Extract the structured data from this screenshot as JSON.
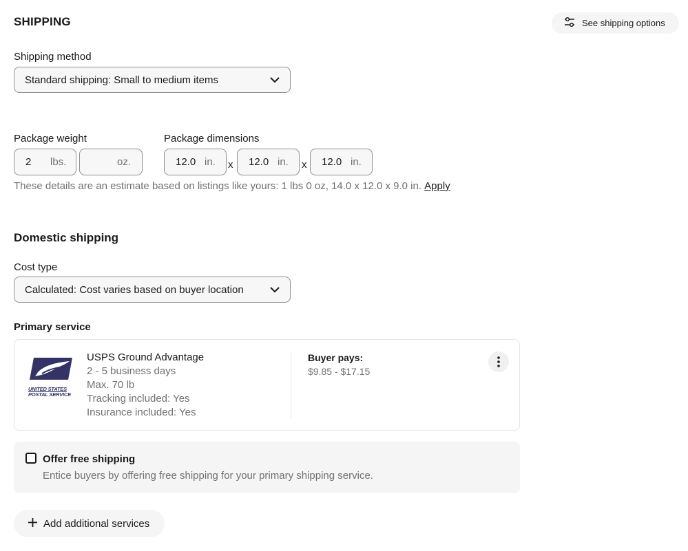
{
  "header": {
    "title": "SHIPPING",
    "options_button": "See shipping options"
  },
  "shipping_method": {
    "label": "Shipping method",
    "value": "Standard shipping: Small to medium items"
  },
  "package": {
    "weight_label": "Package weight",
    "weight_lbs": "2",
    "weight_lbs_unit": "lbs.",
    "weight_oz": "",
    "weight_oz_unit": "oz.",
    "dimensions_label": "Package dimensions",
    "length": "12.0",
    "width": "12.0",
    "height": "12.0",
    "dim_unit": "in.",
    "times": "x",
    "hint": "These details are an estimate based on listings like yours: 1 lbs 0 oz, 14.0 x 12.0 x 9.0 in.",
    "apply_link": "Apply"
  },
  "domestic": {
    "title": "Domestic shipping",
    "cost_type_label": "Cost type",
    "cost_type_value": "Calculated: Cost varies based on buyer location",
    "primary_service_label": "Primary service"
  },
  "service": {
    "logo_text_1": "UNITED STATES",
    "logo_text_2": "POSTAL SERVICE",
    "name": "USPS Ground Advantage",
    "delivery": "2 - 5 business days",
    "max": "Max. 70 lb",
    "tracking": "Tracking included: Yes",
    "insurance": "Insurance included: Yes",
    "buyer_pays_label": "Buyer pays:",
    "buyer_pays_value": "$9.85 - $17.15"
  },
  "free_shipping": {
    "label": "Offer free shipping",
    "description": "Entice buyers by offering free shipping for your primary shipping service."
  },
  "add_services": {
    "label": "Add additional services"
  },
  "colors": {
    "text": "#191919",
    "muted": "#707070",
    "border": "#8f8f8f",
    "usps_blue": "#333366"
  }
}
